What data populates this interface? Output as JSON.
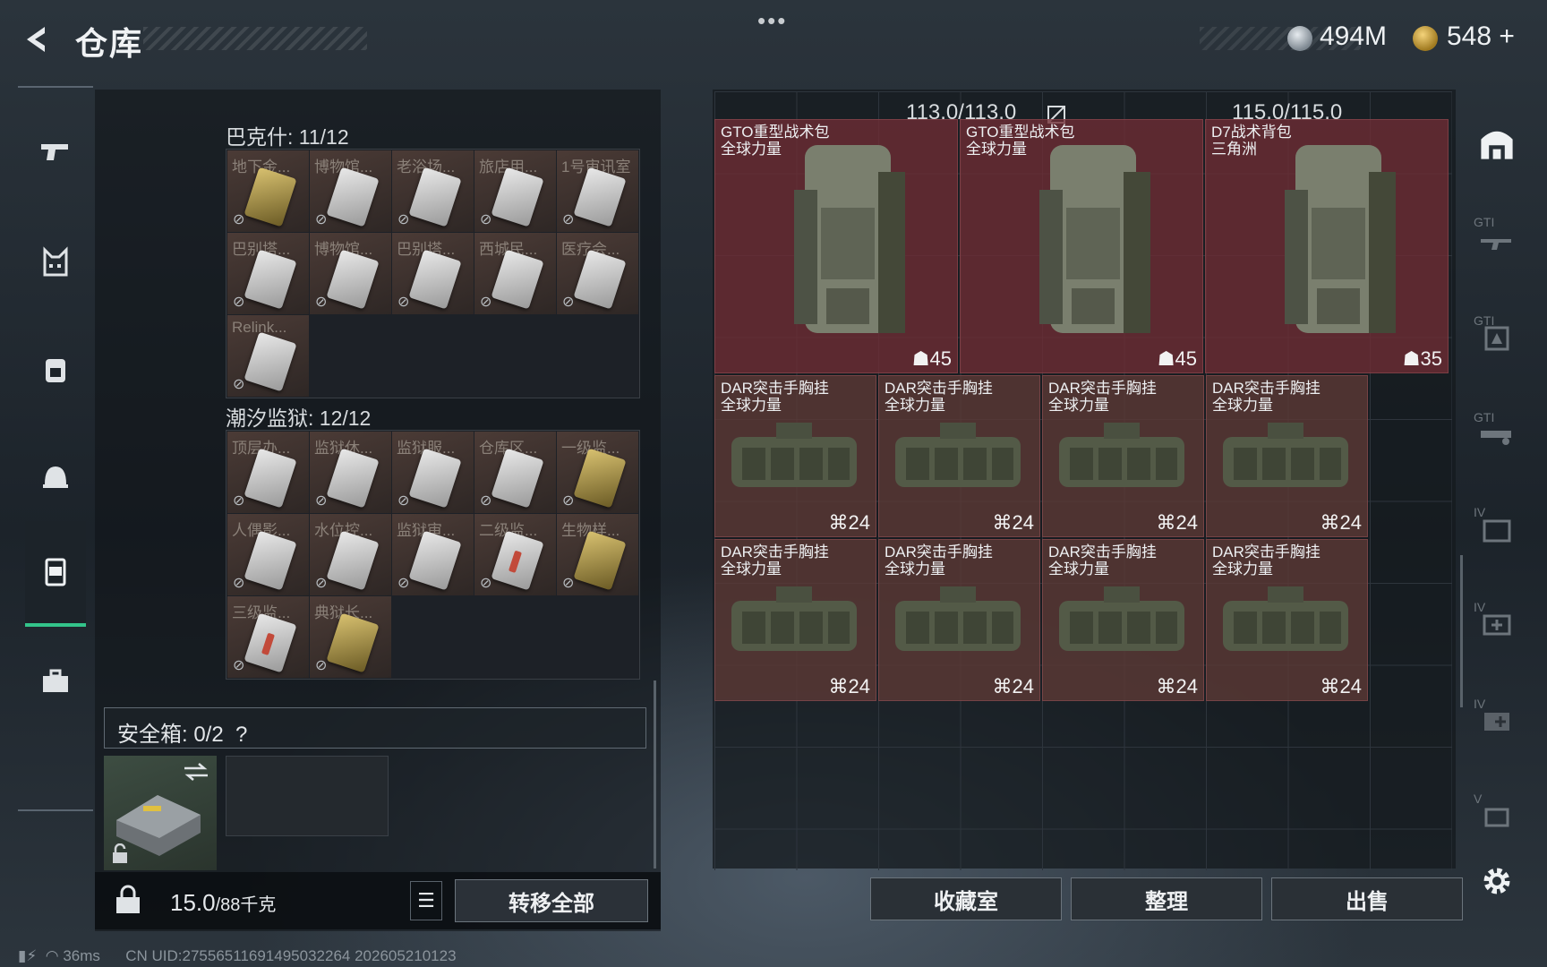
{
  "header": {
    "title": "仓库",
    "currency1": "494M",
    "currency2": "548",
    "currency2_plus": "+"
  },
  "left_tabs": [
    {
      "icon": "pistol-icon"
    },
    {
      "icon": "armor-vest-icon"
    },
    {
      "icon": "backpack-icon"
    },
    {
      "icon": "helmet-icon"
    },
    {
      "icon": "container-icon",
      "active": true
    },
    {
      "icon": "toolbox-icon"
    }
  ],
  "bakeshi": {
    "title": "巴克什: 11/12",
    "cards": [
      {
        "label": "地下金...",
        "color": "yellow"
      },
      {
        "label": "博物馆...",
        "color": "white"
      },
      {
        "label": "老浴场...",
        "color": "white"
      },
      {
        "label": "旅店用...",
        "color": "white"
      },
      {
        "label": "1号审讯室",
        "color": "white"
      },
      {
        "label": "巴别塔...",
        "color": "white"
      },
      {
        "label": "博物馆...",
        "color": "white"
      },
      {
        "label": "巴别塔...",
        "color": "white"
      },
      {
        "label": "西城民...",
        "color": "white"
      },
      {
        "label": "医疗会...",
        "color": "white"
      },
      {
        "label": "Relink...",
        "color": "white"
      }
    ]
  },
  "chaoxi": {
    "title": "潮汐监狱: 12/12",
    "cards": [
      {
        "label": "顶层办...",
        "color": "white"
      },
      {
        "label": "监狱休...",
        "color": "white"
      },
      {
        "label": "监狱服...",
        "color": "white"
      },
      {
        "label": "仓库区...",
        "color": "white"
      },
      {
        "label": "一级监...",
        "color": "yellow"
      },
      {
        "label": "人偶影...",
        "color": "white"
      },
      {
        "label": "水位控...",
        "color": "white"
      },
      {
        "label": "监狱审...",
        "color": "white"
      },
      {
        "label": "二级监...",
        "color": "red"
      },
      {
        "label": "生物样...",
        "color": "yellow"
      },
      {
        "label": "三级监...",
        "color": "red"
      },
      {
        "label": "典狱长...",
        "color": "yellow"
      }
    ]
  },
  "safebox": {
    "label": "安全箱: 0/2",
    "help": "?"
  },
  "weight": {
    "value": "15.0",
    "unit": "/88千克"
  },
  "transfer_all": "转移全部",
  "stash": {
    "weight1": "113.0/113.0",
    "weight2": "115.0/115.0",
    "backpacks": [
      {
        "name": "GTO重型战术包\n全球力量",
        "capacity": "45"
      },
      {
        "name": "GTO重型战术包\n全球力量",
        "capacity": "45"
      },
      {
        "name": "D7战术背包\n三角洲",
        "capacity": "35"
      }
    ],
    "rigs": [
      {
        "name": "DAR突击手胸挂\n全球力量",
        "capacity": "24"
      },
      {
        "name": "DAR突击手胸挂\n全球力量",
        "capacity": "24"
      },
      {
        "name": "DAR突击手胸挂\n全球力量",
        "capacity": "24"
      },
      {
        "name": "DAR突击手胸挂\n全球力量",
        "capacity": "24"
      },
      {
        "name": "DAR突击手胸挂\n全球力量",
        "capacity": "24"
      },
      {
        "name": "DAR突击手胸挂\n全球力量",
        "capacity": "24"
      },
      {
        "name": "DAR突击手胸挂\n全球力量",
        "capacity": "24"
      },
      {
        "name": "DAR突击手胸挂\n全球力量",
        "capacity": "24"
      }
    ]
  },
  "buttons": {
    "collection": "收藏室",
    "sort": "整理",
    "sell": "出售"
  },
  "right_bar": [
    {
      "icon": "warehouse-icon"
    },
    {
      "label": "GTI",
      "icon": "gti-rifle-icon"
    },
    {
      "label": "GTI",
      "icon": "gti-card-icon"
    },
    {
      "label": "GTI",
      "icon": "gti-gun-icon"
    },
    {
      "label": "IV",
      "icon": "iv-folder-icon"
    },
    {
      "label": "IV",
      "icon": "iv-medkit-icon"
    },
    {
      "label": "IV",
      "icon": "iv-kit-icon"
    },
    {
      "label": "V",
      "icon": "v-box-icon"
    },
    {
      "icon": "gear-icon"
    }
  ],
  "status": {
    "ping": "36ms",
    "uid": "CN UID:2755651169149503226​4  202605210123"
  }
}
